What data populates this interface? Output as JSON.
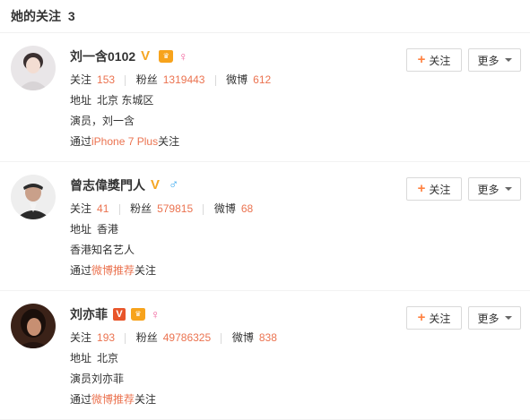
{
  "header": {
    "title": "她的关注",
    "count": "3"
  },
  "users": [
    {
      "name": "刘一含0102",
      "stats": {
        "following_label": "关注",
        "following": "153",
        "fans_label": "粉丝",
        "fans": "1319443",
        "weibo_label": "微博",
        "weibo": "612"
      },
      "address_label": "地址",
      "address": "北京 东城区",
      "bio": "演员，刘一含",
      "via_prefix": "通过",
      "via": "iPhone 7 Plus",
      "via_suffix": "关注",
      "follow_label": "关注",
      "more_label": "更多"
    },
    {
      "name": "曾志偉獎門人",
      "stats": {
        "following_label": "关注",
        "following": "41",
        "fans_label": "粉丝",
        "fans": "579815",
        "weibo_label": "微博",
        "weibo": "68"
      },
      "address_label": "地址",
      "address": "香港",
      "bio": "香港知名艺人",
      "via_prefix": "通过",
      "via": "微博推荐",
      "via_suffix": "关注",
      "follow_label": "关注",
      "more_label": "更多"
    },
    {
      "name": "刘亦菲",
      "stats": {
        "following_label": "关注",
        "following": "193",
        "fans_label": "粉丝",
        "fans": "49786325",
        "weibo_label": "微博",
        "weibo": "838"
      },
      "address_label": "地址",
      "address": "北京",
      "bio": "演员刘亦菲",
      "via_prefix": "通过",
      "via": "微博推荐",
      "via_suffix": "关注",
      "follow_label": "关注",
      "more_label": "更多"
    }
  ],
  "icons": {
    "plus": "plus-icon",
    "caret": "chevron-down-icon",
    "verified": "verified-icon",
    "vip": "vip-crown-icon",
    "female": "female-icon",
    "male": "male-icon"
  },
  "colors": {
    "accent": "#eb7350",
    "verified_orange": "#f5a623",
    "verified_red": "#e8552a",
    "female": "#f0609a",
    "male": "#37a7ee"
  }
}
